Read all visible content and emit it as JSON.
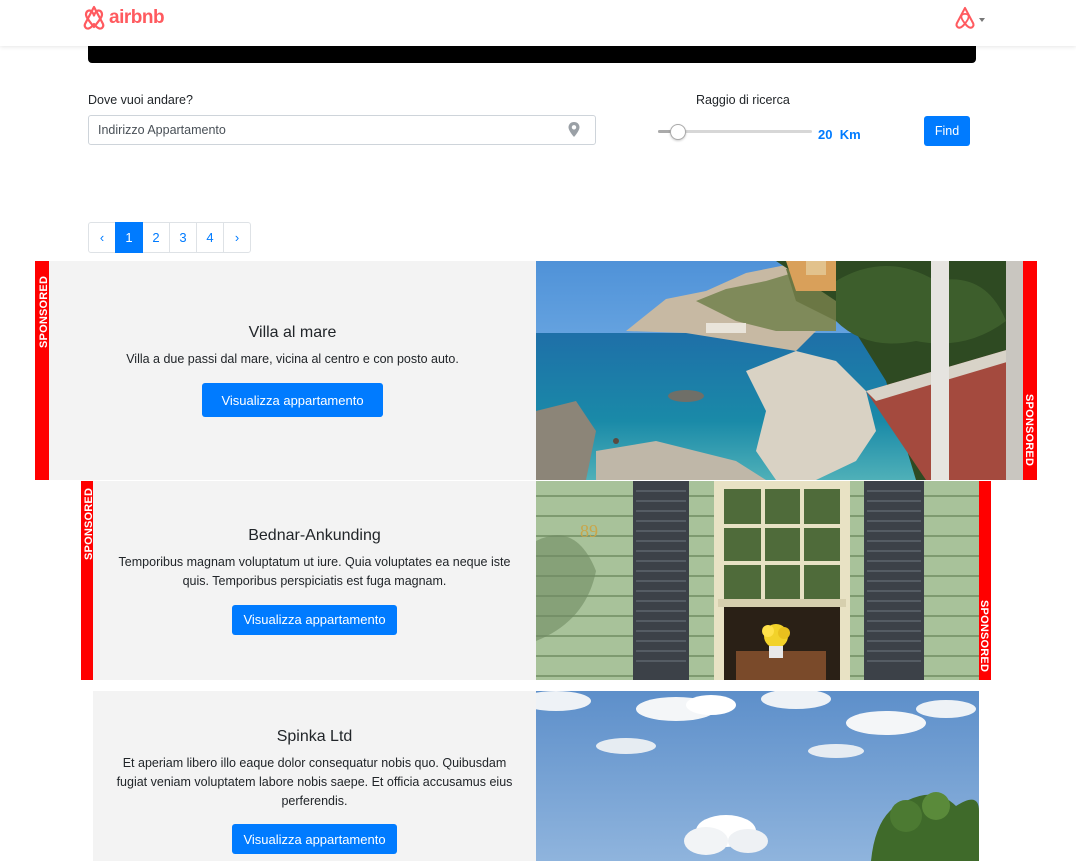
{
  "brand": {
    "name": "airbnb",
    "color": "#ff5a5f"
  },
  "search": {
    "where_label": "Dove vuoi andare?",
    "placeholder": "Indirizzo Appartamento",
    "value": "",
    "radius_label": "Raggio di ricerca",
    "radius_value": "20",
    "radius_unit": "Km",
    "radius_slider_fraction": 0.13,
    "find_label": "Find"
  },
  "pagination": {
    "prev": "‹",
    "pages": [
      "1",
      "2",
      "3",
      "4"
    ],
    "active_page": "1",
    "next": "›"
  },
  "sponsored_label": "SPONSORED",
  "listings": [
    {
      "title": "Villa al mare",
      "description": "Villa a due passi dal mare, vicina al centro e con posto auto.",
      "button": "Visualizza appartamento",
      "sponsored": true
    },
    {
      "title": "Bednar-Ankunding",
      "description": "Temporibus magnam voluptatum ut iure. Quia voluptates ea neque iste quis. Temporibus perspiciatis est fuga magnam.",
      "button": "Visualizza appartamento",
      "sponsored": true,
      "house_number": "89"
    },
    {
      "title": "Spinka Ltd",
      "description": "Et aperiam libero illo eaque dolor consequatur nobis quo. Quibusdam fugiat veniam voluptatem labore nobis saepe. Et officia accusamus eius perferendis.",
      "button": "Visualizza appartamento",
      "sponsored": false
    }
  ],
  "colors": {
    "primary": "#007bff",
    "sponsored": "#ff0000",
    "card_bg": "#f3f3f3"
  }
}
